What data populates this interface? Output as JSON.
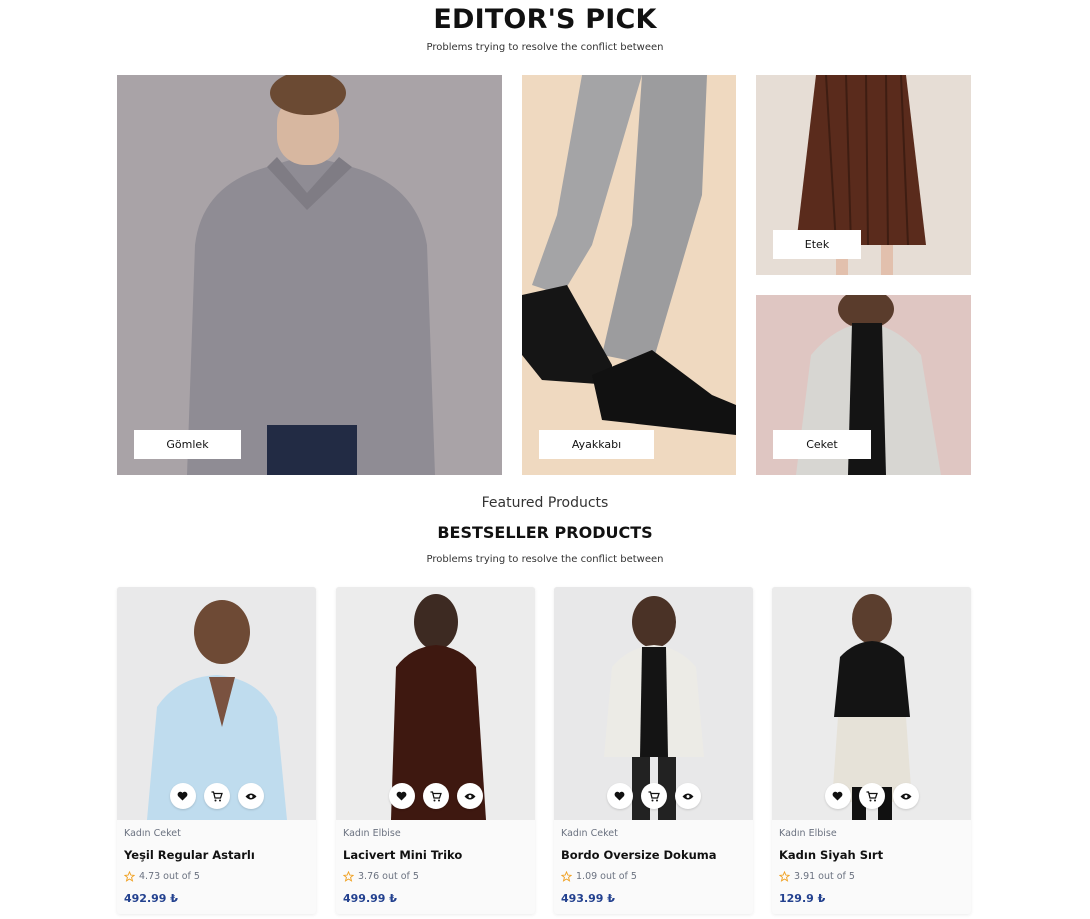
{
  "editors_pick": {
    "title": "EDITOR'S PICK",
    "subtitle": "Problems trying to resolve the conflict between",
    "tiles": [
      {
        "label": "Gömlek"
      },
      {
        "label": "Ayakkabı"
      },
      {
        "label": "Etek"
      },
      {
        "label": "Ceket"
      }
    ]
  },
  "bestseller": {
    "eyebrow": "Featured Products",
    "title": "BESTSELLER PRODUCTS",
    "subtitle": "Problems trying to resolve the conflict between",
    "products": [
      {
        "category": "Kadın Ceket",
        "name": "Yeşil Regular Astarlı",
        "rating": "4.73 out of 5",
        "price": "492.99 ₺"
      },
      {
        "category": "Kadın Elbise",
        "name": "Lacivert Mini Triko",
        "rating": "3.76 out of 5",
        "price": "499.99 ₺"
      },
      {
        "category": "Kadın Ceket",
        "name": "Bordo Oversize Dokuma",
        "rating": "1.09 out of 5",
        "price": "493.99 ₺"
      },
      {
        "category": "Kadın Elbise",
        "name": "Kadın Siyah Sırt",
        "rating": "3.91 out of 5",
        "price": "129.9 ₺"
      }
    ]
  },
  "icons": {
    "wishlist": "heart-icon",
    "cart": "cart-icon",
    "view": "eye-icon",
    "rating": "star-icon"
  },
  "colors": {
    "price": "#23418f",
    "star": "#f0a020"
  }
}
